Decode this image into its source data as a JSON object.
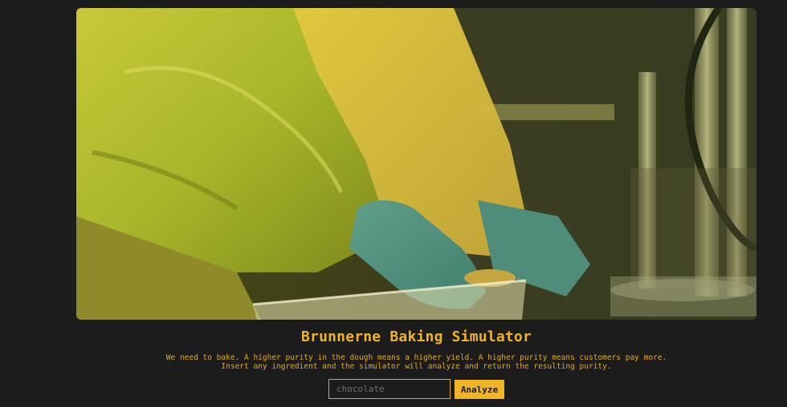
{
  "hero": {
    "image_alt": "Person in a yellow protective suit and green gloves reaching into a plastic container in a lab"
  },
  "header": {
    "title": "Brunnerne Baking Simulator"
  },
  "description": {
    "line1": "We need to bake. A higher purity in the dough means a higher yield. A higher purity means customers pay more.",
    "line2": "Insert any ingredient and the simulator will analyze and return the resulting purity."
  },
  "form": {
    "input_value": "",
    "input_placeholder": "chocolate",
    "button_label": "Analyze"
  },
  "colors": {
    "background": "#1c1c1c",
    "accent": "#f0b429"
  }
}
